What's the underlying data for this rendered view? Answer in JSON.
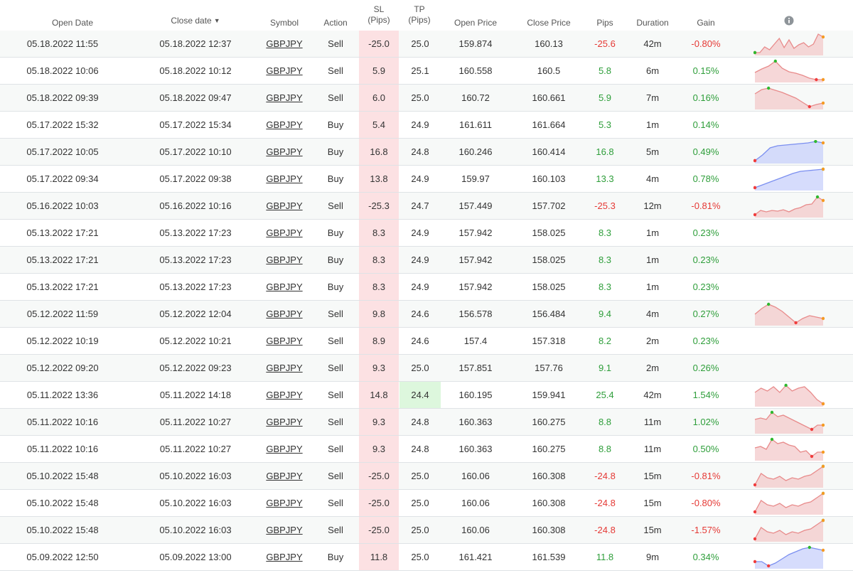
{
  "headers": {
    "open_date": "Open Date",
    "close_date": "Close date",
    "sort_arrow": "▼",
    "symbol": "Symbol",
    "action": "Action",
    "sl_1": "SL",
    "sl_2": "(Pips)",
    "tp_1": "TP",
    "tp_2": "(Pips)",
    "open_price": "Open Price",
    "close_price": "Close Price",
    "pips": "Pips",
    "duration": "Duration",
    "gain": "Gain",
    "info_icon": "info-icon"
  },
  "colors": {
    "negative": "#e53935",
    "positive": "#2e9e3a",
    "sl_cell": "#fce1e3",
    "tp_highlight": "#ddf7dd",
    "sell_spark_line": "#e88b8b",
    "sell_spark_fill": "#f3c9cb",
    "buy_spark_line": "#7b8ff0",
    "buy_spark_fill": "#c8d0fb",
    "marker_red": "#f03c3c",
    "marker_green": "#2eb82e",
    "marker_orange": "#f59a23",
    "marker_blue": "#4b63e6"
  },
  "rows": [
    {
      "open": "05.18.2022 11:55",
      "close": "05.18.2022 12:37",
      "symbol": "GBPJPY",
      "action": "Sell",
      "sl": "-25.0",
      "tp": "25.0",
      "open_price": "159.874",
      "close_price": "160.13",
      "pips": "-25.6",
      "duration": "42m",
      "gain": "-0.80%",
      "spark": {
        "kind": "sell",
        "pts": [
          2,
          2,
          10,
          6,
          14,
          22,
          9,
          20,
          8,
          13,
          16,
          10,
          14,
          28,
          24
        ],
        "min": 0,
        "max": 0
      }
    },
    {
      "open": "05.18.2022 10:06",
      "close": "05.18.2022 10:12",
      "symbol": "GBPJPY",
      "action": "Sell",
      "sl": "5.9",
      "tp": "25.1",
      "open_price": "160.558",
      "close_price": "160.5",
      "pips": "5.8",
      "duration": "6m",
      "gain": "0.15%",
      "spark": {
        "kind": "sell",
        "pts": [
          12,
          17,
          21,
          28,
          18,
          13,
          11,
          8,
          4,
          2,
          2
        ],
        "min": 9,
        "max": 3
      }
    },
    {
      "open": "05.18.2022 09:39",
      "close": "05.18.2022 09:47",
      "symbol": "GBPJPY",
      "action": "Sell",
      "sl": "6.0",
      "tp": "25.0",
      "open_price": "160.72",
      "close_price": "160.661",
      "pips": "5.9",
      "duration": "7m",
      "gain": "0.16%",
      "spark": {
        "kind": "sell",
        "pts": [
          20,
          26,
          28,
          25,
          22,
          18,
          14,
          8,
          2,
          5,
          7
        ],
        "min": 8,
        "max": 2
      }
    },
    {
      "open": "05.17.2022 15:32",
      "close": "05.17.2022 15:34",
      "symbol": "GBPJPY",
      "action": "Buy",
      "sl": "5.4",
      "tp": "24.9",
      "open_price": "161.611",
      "close_price": "161.664",
      "pips": "5.3",
      "duration": "1m",
      "gain": "0.14%",
      "spark": null
    },
    {
      "open": "05.17.2022 10:05",
      "close": "05.17.2022 10:10",
      "symbol": "GBPJPY",
      "action": "Buy",
      "sl": "16.8",
      "tp": "24.8",
      "open_price": "160.246",
      "close_price": "160.414",
      "pips": "16.8",
      "duration": "5m",
      "gain": "0.49%",
      "spark": {
        "kind": "buy",
        "pts": [
          2,
          10,
          20,
          23,
          24,
          25,
          26,
          27,
          29,
          27
        ],
        "min": 0,
        "max": 8
      }
    },
    {
      "open": "05.17.2022 09:34",
      "close": "05.17.2022 09:38",
      "symbol": "GBPJPY",
      "action": "Buy",
      "sl": "13.8",
      "tp": "24.9",
      "open_price": "159.97",
      "close_price": "160.103",
      "pips": "13.3",
      "duration": "4m",
      "gain": "0.78%",
      "spark": {
        "kind": "buy",
        "pts": [
          2,
          6,
          10,
          14,
          18,
          22,
          25,
          26,
          27,
          28
        ],
        "min": 0,
        "max": 9
      }
    },
    {
      "open": "05.16.2022 10:03",
      "close": "05.16.2022 10:16",
      "symbol": "GBPJPY",
      "action": "Sell",
      "sl": "-25.3",
      "tp": "24.7",
      "open_price": "157.449",
      "close_price": "157.702",
      "pips": "-25.3",
      "duration": "12m",
      "gain": "-0.81%",
      "spark": {
        "kind": "sell",
        "pts": [
          2,
          8,
          6,
          8,
          7,
          9,
          6,
          10,
          12,
          16,
          17,
          27,
          22
        ],
        "min": 0,
        "max": 11
      }
    },
    {
      "open": "05.13.2022 17:21",
      "close": "05.13.2022 17:23",
      "symbol": "GBPJPY",
      "action": "Buy",
      "sl": "8.3",
      "tp": "24.9",
      "open_price": "157.942",
      "close_price": "158.025",
      "pips": "8.3",
      "duration": "1m",
      "gain": "0.23%",
      "spark": null
    },
    {
      "open": "05.13.2022 17:21",
      "close": "05.13.2022 17:23",
      "symbol": "GBPJPY",
      "action": "Buy",
      "sl": "8.3",
      "tp": "24.9",
      "open_price": "157.942",
      "close_price": "158.025",
      "pips": "8.3",
      "duration": "1m",
      "gain": "0.23%",
      "spark": null
    },
    {
      "open": "05.13.2022 17:21",
      "close": "05.13.2022 17:23",
      "symbol": "GBPJPY",
      "action": "Buy",
      "sl": "8.3",
      "tp": "24.9",
      "open_price": "157.942",
      "close_price": "158.025",
      "pips": "8.3",
      "duration": "1m",
      "gain": "0.23%",
      "spark": null
    },
    {
      "open": "05.12.2022 11:59",
      "close": "05.12.2022 12:04",
      "symbol": "GBPJPY",
      "action": "Sell",
      "sl": "9.8",
      "tp": "24.6",
      "open_price": "156.578",
      "close_price": "156.484",
      "pips": "9.4",
      "duration": "4m",
      "gain": "0.27%",
      "spark": {
        "kind": "sell",
        "pts": [
          14,
          22,
          28,
          24,
          18,
          10,
          2,
          8,
          12,
          10,
          8
        ],
        "min": 6,
        "max": 2
      }
    },
    {
      "open": "05.12.2022 10:19",
      "close": "05.12.2022 10:21",
      "symbol": "GBPJPY",
      "action": "Sell",
      "sl": "8.9",
      "tp": "24.6",
      "open_price": "157.4",
      "close_price": "157.318",
      "pips": "8.2",
      "duration": "2m",
      "gain": "0.23%",
      "spark": null
    },
    {
      "open": "05.12.2022 09:20",
      "close": "05.12.2022 09:23",
      "symbol": "GBPJPY",
      "action": "Sell",
      "sl": "9.3",
      "tp": "25.0",
      "open_price": "157.851",
      "close_price": "157.76",
      "pips": "9.1",
      "duration": "2m",
      "gain": "0.26%",
      "spark": null
    },
    {
      "open": "05.11.2022 13:36",
      "close": "05.11.2022 14:18",
      "symbol": "GBPJPY",
      "action": "Sell",
      "sl": "14.8",
      "tp": "24.4",
      "tp_highlight": true,
      "open_price": "160.195",
      "close_price": "159.941",
      "pips": "25.4",
      "duration": "42m",
      "gain": "1.54%",
      "spark": {
        "kind": "sell",
        "pts": [
          18,
          24,
          20,
          26,
          18,
          28,
          20,
          24,
          26,
          18,
          8,
          2
        ],
        "min": 11,
        "max": 5
      }
    },
    {
      "open": "05.11.2022 10:16",
      "close": "05.11.2022 10:27",
      "symbol": "GBPJPY",
      "action": "Sell",
      "sl": "9.3",
      "tp": "24.8",
      "open_price": "160.363",
      "close_price": "160.275",
      "pips": "8.8",
      "duration": "11m",
      "gain": "1.02%",
      "spark": {
        "kind": "sell",
        "pts": [
          18,
          20,
          18,
          28,
          22,
          24,
          20,
          16,
          12,
          8,
          4,
          10,
          10
        ],
        "min": 10,
        "max": 3
      }
    },
    {
      "open": "05.11.2022 10:16",
      "close": "05.11.2022 10:27",
      "symbol": "GBPJPY",
      "action": "Sell",
      "sl": "9.3",
      "tp": "24.8",
      "open_price": "160.363",
      "close_price": "160.275",
      "pips": "8.8",
      "duration": "11m",
      "gain": "0.50%",
      "spark": {
        "kind": "sell",
        "pts": [
          16,
          18,
          14,
          28,
          22,
          24,
          20,
          18,
          10,
          12,
          4,
          10,
          10
        ],
        "min": 10,
        "max": 3
      }
    },
    {
      "open": "05.10.2022 15:48",
      "close": "05.10.2022 16:03",
      "symbol": "GBPJPY",
      "action": "Sell",
      "sl": "-25.0",
      "tp": "25.0",
      "open_price": "160.06",
      "close_price": "160.308",
      "pips": "-24.8",
      "duration": "15m",
      "gain": "-0.81%",
      "spark": {
        "kind": "sell",
        "pts": [
          2,
          18,
          12,
          10,
          14,
          8,
          12,
          10,
          14,
          16,
          22,
          28
        ],
        "min": 0,
        "max": 11
      }
    },
    {
      "open": "05.10.2022 15:48",
      "close": "05.10.2022 16:03",
      "symbol": "GBPJPY",
      "action": "Sell",
      "sl": "-25.0",
      "tp": "25.0",
      "open_price": "160.06",
      "close_price": "160.308",
      "pips": "-24.8",
      "duration": "15m",
      "gain": "-0.80%",
      "spark": {
        "kind": "sell",
        "pts": [
          2,
          18,
          12,
          10,
          14,
          8,
          12,
          10,
          14,
          16,
          22,
          28
        ],
        "min": 0,
        "max": 11
      }
    },
    {
      "open": "05.10.2022 15:48",
      "close": "05.10.2022 16:03",
      "symbol": "GBPJPY",
      "action": "Sell",
      "sl": "-25.0",
      "tp": "25.0",
      "open_price": "160.06",
      "close_price": "160.308",
      "pips": "-24.8",
      "duration": "15m",
      "gain": "-1.57%",
      "spark": {
        "kind": "sell",
        "pts": [
          2,
          18,
          12,
          10,
          14,
          8,
          12,
          10,
          14,
          16,
          22,
          28
        ],
        "min": 0,
        "max": 11
      }
    },
    {
      "open": "05.09.2022 12:50",
      "close": "05.09.2022 13:00",
      "symbol": "GBPJPY",
      "action": "Buy",
      "sl": "11.8",
      "tp": "25.0",
      "open_price": "161.421",
      "close_price": "161.539",
      "pips": "11.8",
      "duration": "9m",
      "gain": "0.34%",
      "spark": {
        "kind": "buy",
        "pts": [
          8,
          8,
          2,
          6,
          12,
          18,
          22,
          26,
          28,
          26,
          24
        ],
        "min": 2,
        "max": 8
      }
    }
  ]
}
